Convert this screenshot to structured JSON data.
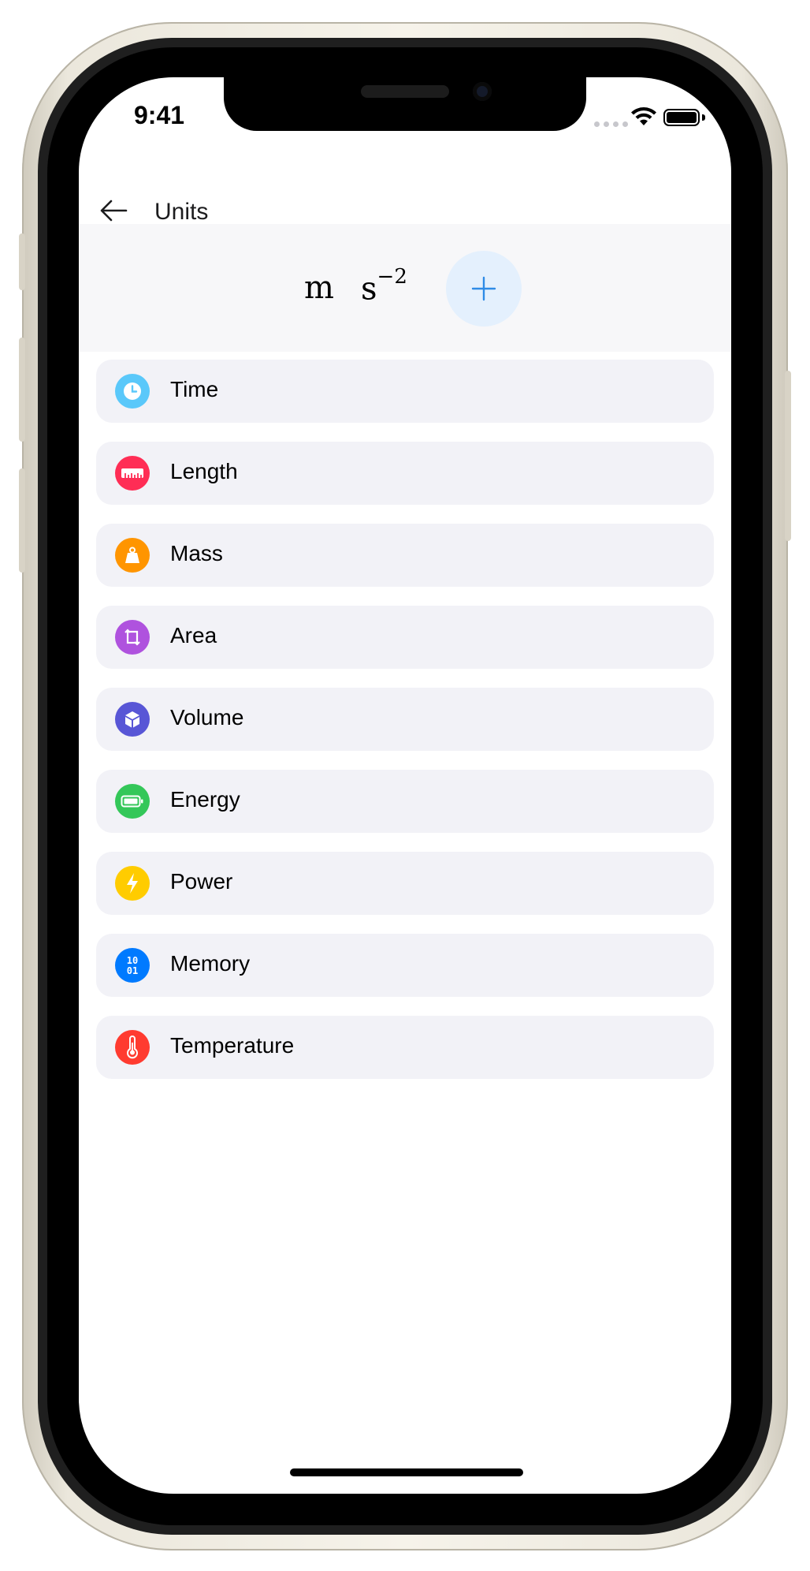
{
  "status_bar": {
    "time": "9:41"
  },
  "nav": {
    "title": "Units"
  },
  "formula": {
    "tokens": [
      {
        "symbol": "m",
        "exponent": ""
      },
      {
        "symbol": "s",
        "exponent": "−2"
      }
    ]
  },
  "categories": [
    {
      "label": "Time",
      "icon": "clock-icon",
      "color": "#5ac8fa"
    },
    {
      "label": "Length",
      "icon": "ruler-icon",
      "color": "#ff2d55"
    },
    {
      "label": "Mass",
      "icon": "weight-icon",
      "color": "#ff9500"
    },
    {
      "label": "Area",
      "icon": "area-icon",
      "color": "#af52de"
    },
    {
      "label": "Volume",
      "icon": "cube-icon",
      "color": "#5856d6"
    },
    {
      "label": "Energy",
      "icon": "battery-icon",
      "color": "#34c759"
    },
    {
      "label": "Power",
      "icon": "bolt-icon",
      "color": "#ffcc00"
    },
    {
      "label": "Memory",
      "icon": "binary-icon",
      "color": "#007aff"
    },
    {
      "label": "Temperature",
      "icon": "thermometer-icon",
      "color": "#ff3b30"
    }
  ],
  "colors": {
    "accent": "#2f8be6",
    "add_button_bg": "#e4f0fd",
    "row_bg": "#f2f2f7"
  }
}
